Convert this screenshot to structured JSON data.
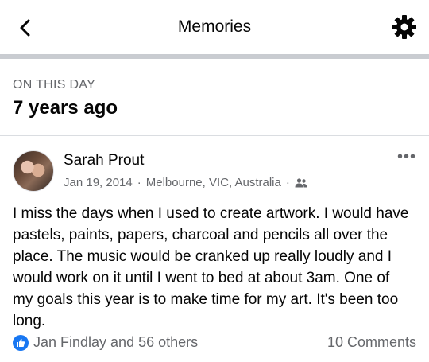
{
  "header": {
    "title": "Memories",
    "back_icon": "chevron-left-icon",
    "settings_icon": "gear-icon"
  },
  "on_this_day": {
    "label": "ON THIS DAY",
    "ago": "7 years ago"
  },
  "post": {
    "author": "Sarah Prout",
    "date": "Jan 19, 2014",
    "separator": "·",
    "location": "Melbourne, VIC, Australia",
    "audience_icon": "friends-icon",
    "more_label": "•••",
    "text": "I miss the days when I used to create artwork. I would have pastels, paints, papers, charcoal and pencils all over the place. The music would be cranked up really loudly and I would work on it until I went to bed at about 3am. One of my goals this year is to make time for my art. It's been too long.",
    "reactions": "Jan Findlay and 56 others",
    "comments": "10 Comments"
  },
  "colors": {
    "accent": "#1877f2",
    "secondary_text": "#65676b",
    "divider": "#c9ccd1"
  }
}
